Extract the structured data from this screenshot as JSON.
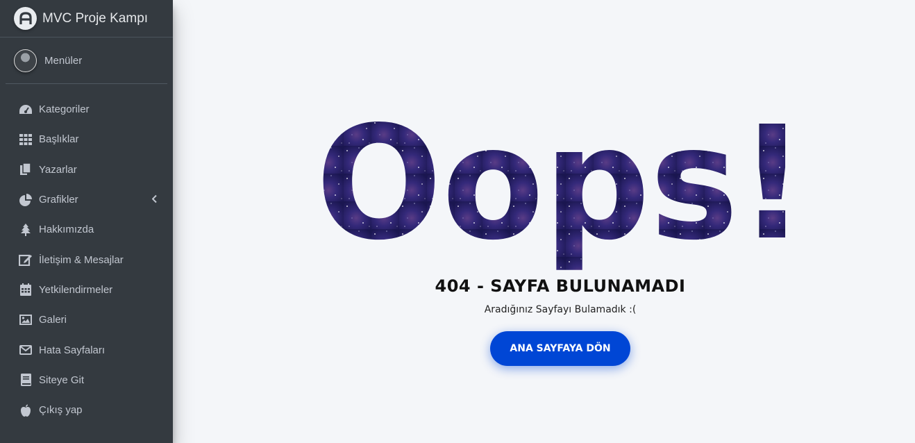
{
  "brand": {
    "title": "MVC Proje Kampı"
  },
  "user": {
    "name": "Menüler"
  },
  "sidebar": {
    "items": [
      {
        "label": "Kategoriler",
        "icon": "dashboard-icon"
      },
      {
        "label": "Başlıklar",
        "icon": "grid-icon"
      },
      {
        "label": "Yazarlar",
        "icon": "copy-icon"
      },
      {
        "label": "Grafikler",
        "icon": "pie-chart-icon"
      },
      {
        "label": "Hakkımızda",
        "icon": "tree-icon"
      },
      {
        "label": "İletişim & Mesajlar",
        "icon": "edit-icon"
      },
      {
        "label": "Yetkilendirmeler",
        "icon": "calendar-icon"
      },
      {
        "label": "Galeri",
        "icon": "image-icon"
      },
      {
        "label": "Hata Sayfaları",
        "icon": "envelope-icon"
      },
      {
        "label": "Siteye Git",
        "icon": "book-icon"
      },
      {
        "label": "Çıkış yap",
        "icon": "apple-icon"
      }
    ]
  },
  "error": {
    "headline": "Oops!",
    "title": "404 - SAYFA BULUNAMADI",
    "description": "Aradığınız Sayfayı Bulamadık :(",
    "button_label": "ANA SAYFAYA DÖN"
  },
  "colors": {
    "sidebar_bg": "#343a40",
    "page_bg": "#f4f6f9",
    "button_bg": "#0046d5",
    "oops_fill": "#2b2470"
  }
}
